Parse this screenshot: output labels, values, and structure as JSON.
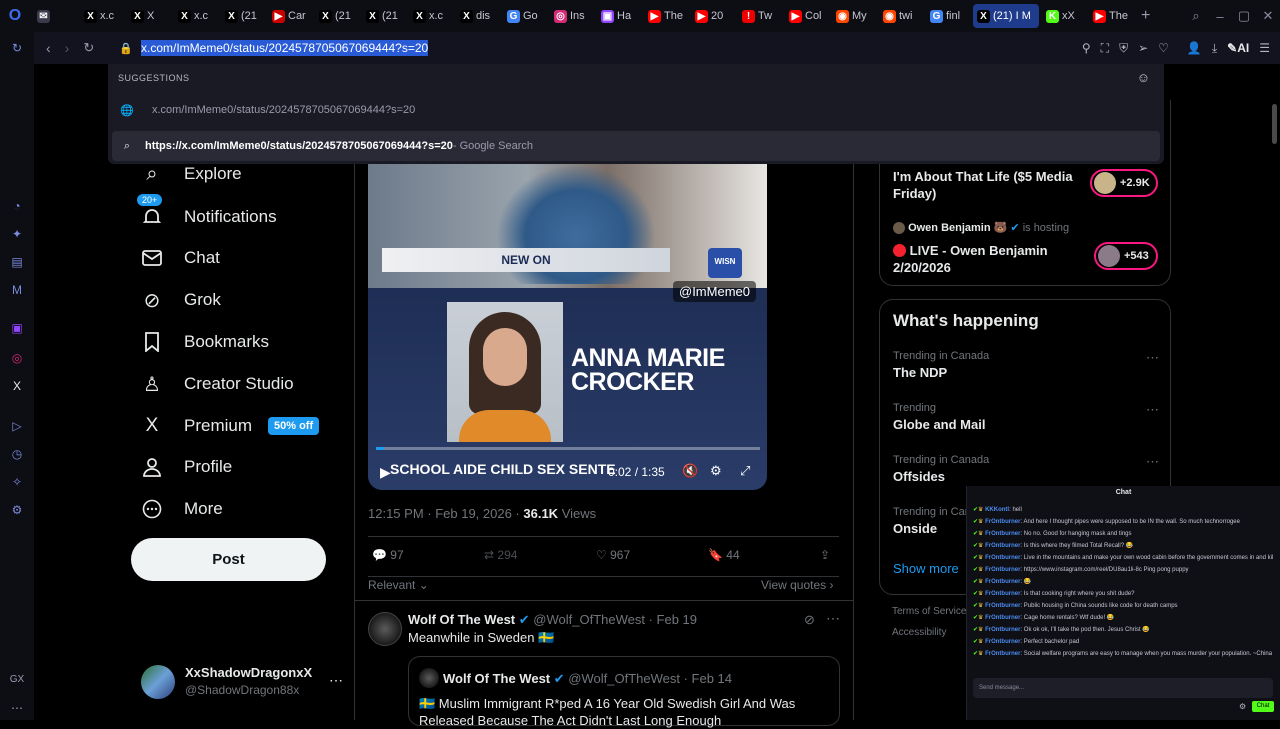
{
  "browser": {
    "tabs": [
      {
        "label": "",
        "fav": "✉",
        "color": "#3a3a4a"
      },
      {
        "label": "x.c",
        "fav": "X",
        "color": "#000"
      },
      {
        "label": "X",
        "fav": "X",
        "color": "#000"
      },
      {
        "label": "x.c",
        "fav": "X",
        "color": "#000"
      },
      {
        "label": "(21",
        "fav": "X",
        "color": "#000"
      },
      {
        "label": "Car",
        "fav": "▶",
        "color": "#c00"
      },
      {
        "label": "(21",
        "fav": "X",
        "color": "#000"
      },
      {
        "label": "(21",
        "fav": "X",
        "color": "#000"
      },
      {
        "label": "x.c",
        "fav": "X",
        "color": "#000"
      },
      {
        "label": "dis",
        "fav": "X",
        "color": "#000"
      },
      {
        "label": "Go",
        "fav": "G",
        "color": "#4285f4"
      },
      {
        "label": "Ins",
        "fav": "◎",
        "color": "#d62976"
      },
      {
        "label": "Ha",
        "fav": "▣",
        "color": "#9146ff"
      },
      {
        "label": "The",
        "fav": "▶",
        "color": "#f00"
      },
      {
        "label": "20",
        "fav": "▶",
        "color": "#f00"
      },
      {
        "label": "Tw",
        "fav": "!",
        "color": "#e00"
      },
      {
        "label": "Col",
        "fav": "▶",
        "color": "#f00"
      },
      {
        "label": "My",
        "fav": "◉",
        "color": "#ff4500"
      },
      {
        "label": "twi",
        "fav": "◉",
        "color": "#ff4500"
      },
      {
        "label": "finl",
        "fav": "G",
        "color": "#4285f4"
      },
      {
        "label": "(21) I M",
        "fav": "X",
        "color": "#000",
        "active": true
      },
      {
        "label": "xX",
        "fav": "K",
        "color": "#53fc18"
      },
      {
        "label": "The",
        "fav": "▶",
        "color": "#f00"
      }
    ],
    "address": "x.com/ImMeme0/status/2024578705067069444?s=20",
    "suggestions_header": "SUGGESTIONS",
    "suggestion_1": "x.com/ImMeme0/status/2024578705067069444?s=20",
    "suggestion_2_bold": "https://x.com/ImMeme0/status/2024578705067069444?s=20",
    "suggestion_2_suffix": " - Google Search",
    "ai_label": "AI"
  },
  "nav": {
    "explore": "Explore",
    "notifications": "Notifications",
    "notif_badge": "20+",
    "chat": "Chat",
    "grok": "Grok",
    "bookmarks": "Bookmarks",
    "creator_studio": "Creator Studio",
    "premium": "Premium",
    "premium_badge": "50% off",
    "profile": "Profile",
    "more": "More",
    "post": "Post"
  },
  "account": {
    "name": "XxShadowDragonxX",
    "handle": "@ShadowDragon88x"
  },
  "video": {
    "new_on": "NEW ON",
    "station": "WISN",
    "watermark": "@ImMeme0",
    "name_line1": "ANNA MARIE",
    "name_line2": "CROCKER",
    "caption": "SCHOOL AIDE CHILD SEX SENTE",
    "time": "0:02 / 1:35",
    "progress": 0.02
  },
  "tweet": {
    "time": "12:15 PM · Feb 19, 2026 · ",
    "views_count": "36.1K",
    "views_label": " Views",
    "replies": "97",
    "retweets": "294",
    "likes": "967",
    "bookmarks": "44",
    "sort": "Relevant",
    "view_quotes": "View quotes"
  },
  "reply": {
    "name": "Wolf Of The West",
    "handle": "@Wolf_OfTheWest · Feb 19",
    "text": "Meanwhile in Sweden 🇸🇪",
    "quote_name": "Wolf Of The West",
    "quote_handle": "@Wolf_OfTheWest · Feb 14",
    "quote_text": "🇸🇪 Muslim Immigrant R*ped A 16 Year Old Swedish Girl And Was Released Because The Act Didn't Last Long Enough"
  },
  "spaces": {
    "item1_title": "I'm About That Life ($5 Media Friday)",
    "item1_count": "+2.9K",
    "item2_host": "Owen Benjamin 🐻",
    "item2_hosting": "is hosting",
    "item2_title": "LIVE - Owen Benjamin 2/20/2026",
    "item2_count": "+543"
  },
  "happening": {
    "title": "What's happening",
    "trends": [
      {
        "sub": "Trending in Canada",
        "name": "The NDP"
      },
      {
        "sub": "Trending",
        "name": "Globe and Mail"
      },
      {
        "sub": "Trending in Canada",
        "name": "Offsides"
      },
      {
        "sub": "Trending in Canada",
        "name": "Onside"
      }
    ],
    "show_more": "Show more",
    "footer1": "Terms of Service",
    "footer2": "Accessibility"
  },
  "chat": {
    "title": "Chat",
    "messages": [
      {
        "user": "KKKontl",
        "text": "hell"
      },
      {
        "user": "FrOntburner",
        "text": "And here I thought pipes were supposed to be IN the wall. So much technorrogee"
      },
      {
        "user": "FrOntburner",
        "text": "No no. Good for hanging mask and tings"
      },
      {
        "user": "FrOntburner",
        "text": "Is this where they filmed Total Recall? 😂"
      },
      {
        "user": "FrOntburner",
        "text": "Live in the mountains and make your own wood cabin before the government comes in and kills your dog."
      },
      {
        "user": "FrOntburner",
        "text": "https://www.instagram.com/reel/DU8au1li-8c Ping pong puppy"
      },
      {
        "user": "FrOntburner",
        "text": "😂"
      },
      {
        "user": "FrOntburner",
        "text": "Is that cooking right where you shit dude?"
      },
      {
        "user": "FrOntburner",
        "text": "Public housing in China sounds like code for death camps"
      },
      {
        "user": "FrOntburner",
        "text": "Cage home rentals? Wtf dude! 😂"
      },
      {
        "user": "FrOntburner",
        "text": "Ok ok ok, I'll take the pod then. Jesus Christ 😂"
      },
      {
        "user": "FrOntburner",
        "text": "Perfect bachelor pad"
      },
      {
        "user": "FrOntburner",
        "text": "Social welfare programs are easy to manage when you mass murder your population. ~China"
      }
    ],
    "placeholder": "Send message...",
    "send": "Chat"
  }
}
